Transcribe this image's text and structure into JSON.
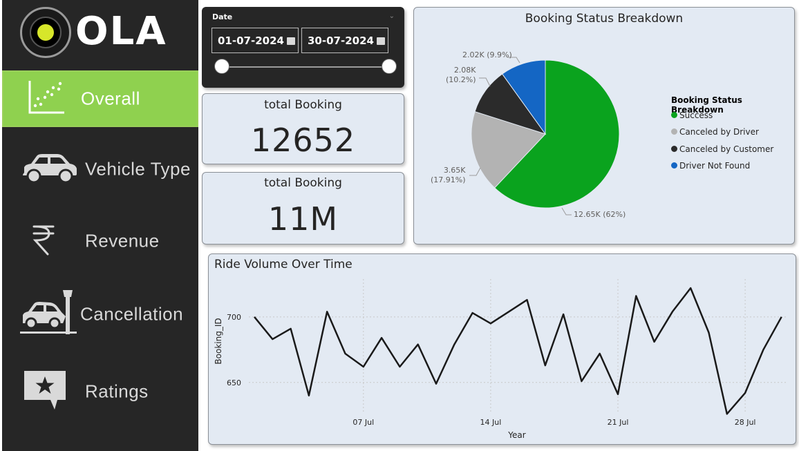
{
  "brand": {
    "logo_text": "OLA"
  },
  "nav": {
    "items": [
      {
        "label": "Overall",
        "icon": "scatter-chart-icon",
        "active": true
      },
      {
        "label": "Vehicle Type",
        "icon": "car-icon",
        "active": false
      },
      {
        "label": "Revenue",
        "icon": "rupee-icon",
        "active": false
      },
      {
        "label": "Cancellation",
        "icon": "car-crash-icon",
        "active": false
      },
      {
        "label": "Ratings",
        "icon": "star-comment-icon",
        "active": false
      }
    ]
  },
  "date_slicer": {
    "title": "Date",
    "start": "01-07-2024",
    "end": "30-07-2024"
  },
  "kpis": [
    {
      "title": "total Booking",
      "value": "12652"
    },
    {
      "title": "total Booking",
      "value": "11M"
    }
  ],
  "pie": {
    "title": "Booking Status Breakdown",
    "legend_title": "Booking Status Breakdown",
    "slices": [
      {
        "name": "Success",
        "value": 12.65,
        "label": "12.65K (62%)",
        "color": "#0aa31e"
      },
      {
        "name": "Canceled by Driver",
        "value": 3.65,
        "label_line1": "3.65K",
        "label_line2": "(17.91%)",
        "color": "#b3b3b3"
      },
      {
        "name": "Canceled by Customer",
        "value": 2.08,
        "label_line1": "2.08K",
        "label_line2": "(10.2%)",
        "color": "#2b2b2b"
      },
      {
        "name": "Driver Not Found",
        "value": 2.02,
        "label": "2.02K (9.9%)",
        "color": "#1466c4"
      }
    ]
  },
  "chart_data": {
    "type": "line",
    "title": "Ride Volume Over Time",
    "xlabel": "Year",
    "ylabel": "Booking_ID",
    "x_ticks": [
      "07 Jul",
      "14 Jul",
      "21 Jul",
      "28 Jul"
    ],
    "y_ticks": [
      650,
      700
    ],
    "ylim": [
      623,
      731
    ],
    "x": [
      "2024-07-01",
      "2024-07-02",
      "2024-07-03",
      "2024-07-04",
      "2024-07-05",
      "2024-07-06",
      "2024-07-07",
      "2024-07-08",
      "2024-07-09",
      "2024-07-10",
      "2024-07-11",
      "2024-07-12",
      "2024-07-13",
      "2024-07-14",
      "2024-07-15",
      "2024-07-16",
      "2024-07-17",
      "2024-07-18",
      "2024-07-19",
      "2024-07-20",
      "2024-07-21",
      "2024-07-22",
      "2024-07-23",
      "2024-07-24",
      "2024-07-25",
      "2024-07-26",
      "2024-07-27",
      "2024-07-28",
      "2024-07-29",
      "2024-07-30"
    ],
    "series": [
      {
        "values": [
          700,
          683,
          691,
          640,
          704,
          672,
          662,
          684,
          662,
          679,
          649,
          679,
          703,
          695,
          704,
          713,
          663,
          702,
          651,
          672,
          641,
          716,
          681,
          704,
          722,
          688,
          626,
          642,
          675,
          700
        ]
      }
    ],
    "grid": true,
    "line_color": "#1a1a1a"
  }
}
